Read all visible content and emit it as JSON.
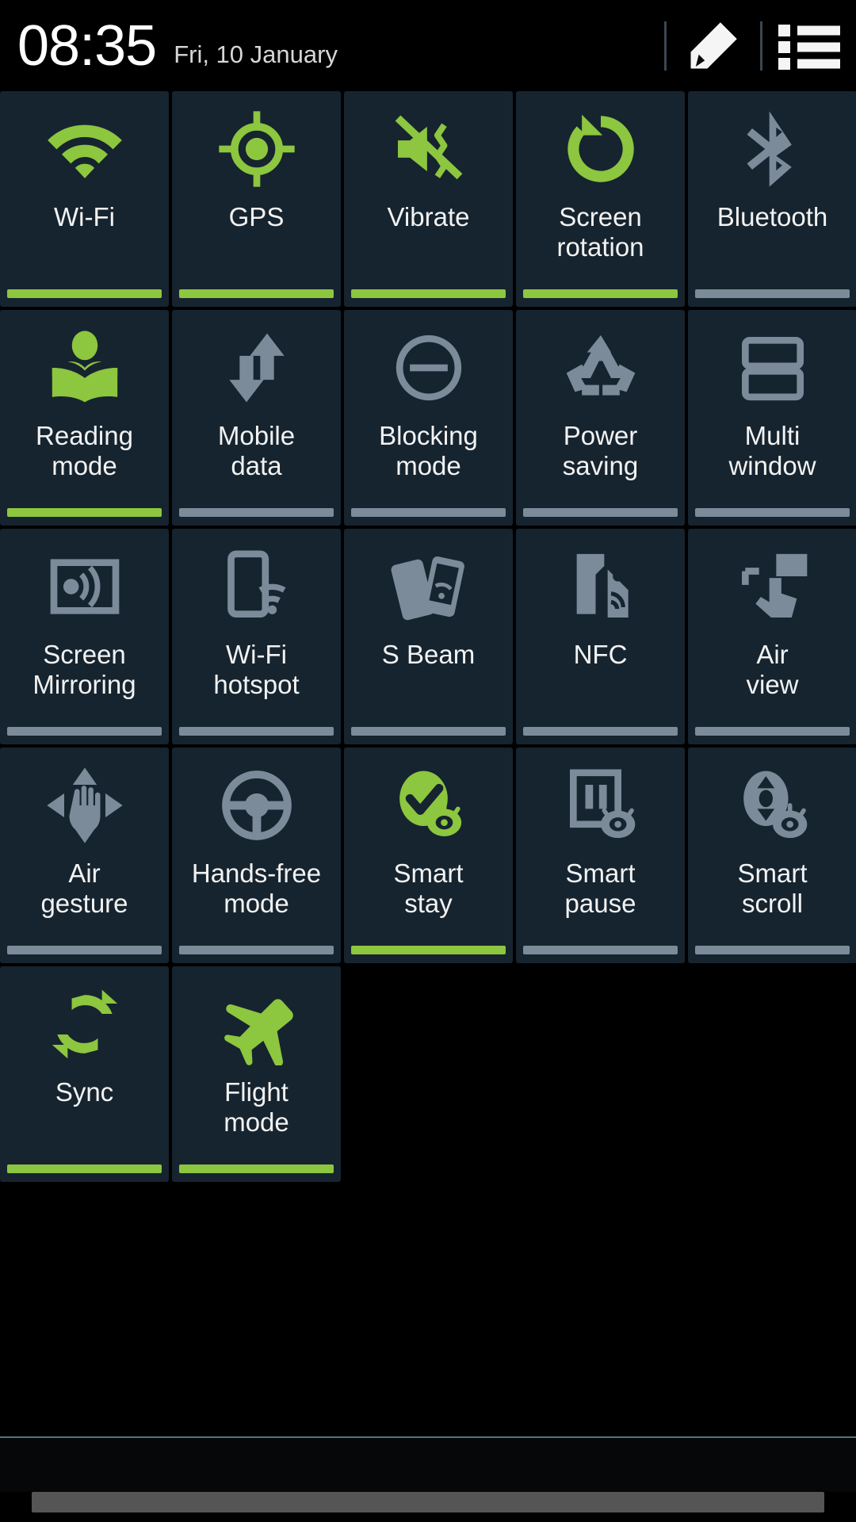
{
  "header": {
    "time": "08:35",
    "date": "Fri, 10 January",
    "edit_icon": "pencil-icon",
    "menu_icon": "list-icon"
  },
  "colors": {
    "active": "#8dc63f",
    "inactive": "#7c8b99",
    "tile_bg": "#16242f",
    "screen_bg": "#000000",
    "label": "#f2f2f2"
  },
  "quick_settings": {
    "tiles": [
      {
        "label": "Wi-Fi",
        "icon": "wifi-icon",
        "state": "on"
      },
      {
        "label": "GPS",
        "icon": "gps-icon",
        "state": "on"
      },
      {
        "label": "Vibrate",
        "icon": "vibrate-icon",
        "state": "on"
      },
      {
        "label": "Screen\nrotation",
        "icon": "screen-rotation-icon",
        "state": "on"
      },
      {
        "label": "Bluetooth",
        "icon": "bluetooth-icon",
        "state": "off"
      },
      {
        "label": "Reading\nmode",
        "icon": "reading-mode-icon",
        "state": "on"
      },
      {
        "label": "Mobile\ndata",
        "icon": "mobile-data-icon",
        "state": "off"
      },
      {
        "label": "Blocking\nmode",
        "icon": "blocking-mode-icon",
        "state": "off"
      },
      {
        "label": "Power\nsaving",
        "icon": "power-saving-icon",
        "state": "off"
      },
      {
        "label": "Multi\nwindow",
        "icon": "multi-window-icon",
        "state": "off"
      },
      {
        "label": "Screen\nMirroring",
        "icon": "screen-mirroring-icon",
        "state": "off"
      },
      {
        "label": "Wi-Fi\nhotspot",
        "icon": "wifi-hotspot-icon",
        "state": "off"
      },
      {
        "label": "S Beam",
        "icon": "s-beam-icon",
        "state": "off"
      },
      {
        "label": "NFC",
        "icon": "nfc-icon",
        "state": "off"
      },
      {
        "label": "Air\nview",
        "icon": "air-view-icon",
        "state": "off"
      },
      {
        "label": "Air\ngesture",
        "icon": "air-gesture-icon",
        "state": "off"
      },
      {
        "label": "Hands-free\nmode",
        "icon": "hands-free-icon",
        "state": "off"
      },
      {
        "label": "Smart\nstay",
        "icon": "smart-stay-icon",
        "state": "on"
      },
      {
        "label": "Smart\npause",
        "icon": "smart-pause-icon",
        "state": "off"
      },
      {
        "label": "Smart\nscroll",
        "icon": "smart-scroll-icon",
        "state": "off"
      },
      {
        "label": "Sync",
        "icon": "sync-icon",
        "state": "on"
      },
      {
        "label": "Flight\nmode",
        "icon": "flight-mode-icon",
        "state": "on"
      }
    ]
  },
  "notification_panel": {
    "handle": "drag-handle"
  }
}
